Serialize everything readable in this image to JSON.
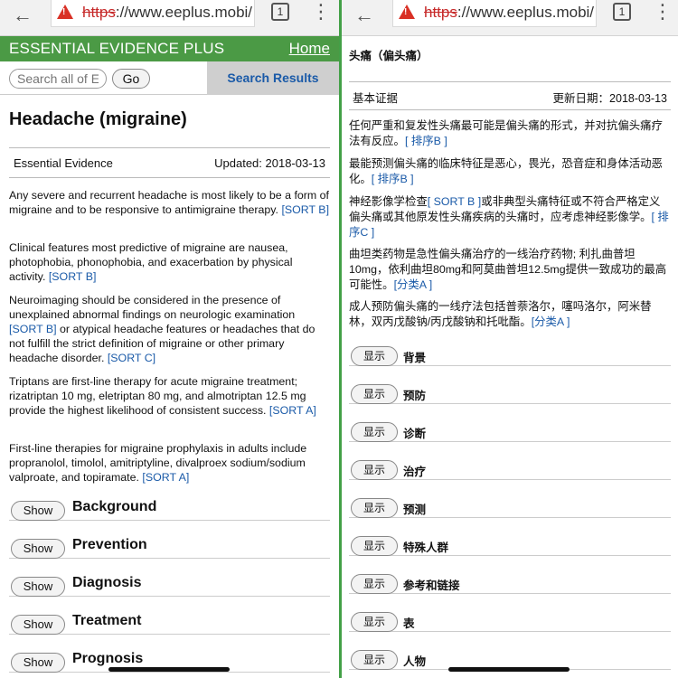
{
  "left": {
    "browser": {
      "url_protocol": "https",
      "url_rest": "://www.eeplus.mobi/",
      "tab_count": "1"
    },
    "header": {
      "brand": "ESSENTIAL EVIDENCE PLUS",
      "home_link": "Home"
    },
    "search": {
      "placeholder": "Search all of EE",
      "go_label": "Go",
      "results_tab": "Search Results"
    },
    "title": "Headache (migraine)",
    "meta": {
      "label": "Essential Evidence",
      "updated": "Updated: 2018-03-13"
    },
    "paragraphs": [
      {
        "text": "Any severe and recurrent headache is most likely to be a form of migraine and to be responsive to antimigraine therapy. ",
        "sort": "[SORT B]",
        "tail": ""
      },
      {
        "text": "Clinical features most predictive of migraine are nausea, photophobia, phonophobia, and exacerbation by physical activity. ",
        "sort": "[SORT B]",
        "tail": ""
      },
      {
        "text": "Neuroimaging should be considered in the presence of unexplained abnormal findings on neurologic examination ",
        "sort": "[SORT B]",
        "tail": " or atypical headache features or headaches that do not fulfill the strict definition of migraine or other primary headache disorder. ",
        "sort2": "[SORT C]"
      },
      {
        "text": "Triptans are first-line therapy for acute migraine treatment; rizatriptan 10 mg, eletriptan 80 mg, and almotriptan 12.5 mg provide the highest likelihood of consistent success. ",
        "sort": "[SORT A]",
        "tail": ""
      },
      {
        "text": "First-line therapies for migraine prophylaxis in adults include propranolol, timolol, amitriptyline, divalproex sodium/sodium valproate, and topiramate. ",
        "sort": "[SORT A]",
        "tail": ""
      }
    ],
    "show_label": "Show",
    "sections": [
      "Background",
      "Prevention",
      "Diagnosis",
      "Treatment",
      "Prognosis"
    ]
  },
  "right": {
    "browser": {
      "url_protocol": "https",
      "url_rest": "://www.eeplus.mobi/",
      "tab_count": "1"
    },
    "title": "头痛（偏头痛）",
    "meta": {
      "label": "基本证据",
      "updated": "更新日期：2018-03-13"
    },
    "paragraphs": [
      {
        "text": "任何严重和复发性头痛最可能是偏头痛的形式，并对抗偏头痛疗法有反应。",
        "sort": "[ 排序B ]"
      },
      {
        "text": "最能预测偏头痛的临床特征是恶心，畏光，恐音症和身体活动恶化。",
        "sort": "[ 排序B ]"
      },
      {
        "text": "神经影像学检查",
        "sort": "[ SORT B ]",
        "tail": "或非典型头痛特征或不符合严格定义偏头痛或其他原发性头痛疾病的头痛时，应考虑神经影像学。",
        "sort2": "[ 排序C ]"
      },
      {
        "text": "曲坦类药物是急性偏头痛治疗的一线治疗药物; 利扎曲普坦10mg，依利曲坦80mg和阿莫曲普坦12.5mg提供一致成功的最高可能性。",
        "sort": "[分类A ]"
      },
      {
        "text": "成人预防偏头痛的一线疗法包括普萘洛尔，噻吗洛尔，阿米替林，双丙戊酸钠/丙戊酸钠和托吡酯。",
        "sort": "[分类A ]"
      }
    ],
    "show_label": "显示",
    "sections": [
      "背景",
      "预防",
      "诊断",
      "治疗",
      "预测",
      "特殊人群",
      "参考和链接",
      "表",
      "人物"
    ]
  },
  "colors": {
    "brand_green": "#4b9a45",
    "link_blue": "#1a5aa8",
    "warning_red": "#d93025"
  }
}
